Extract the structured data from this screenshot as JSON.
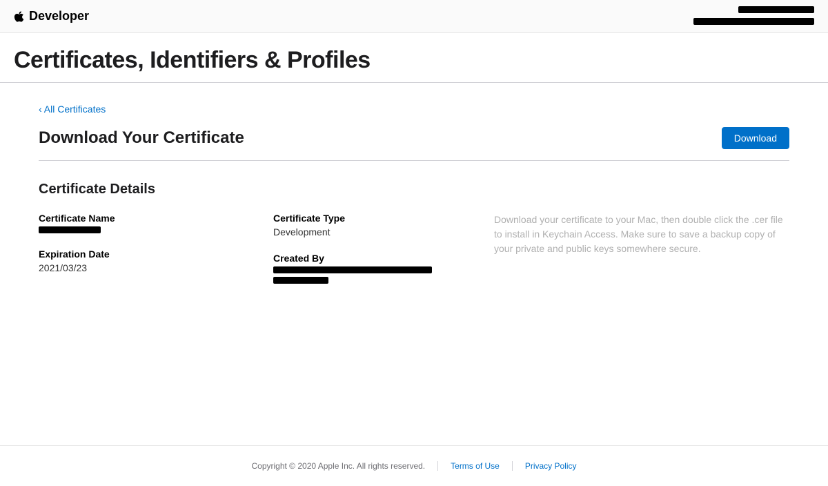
{
  "header": {
    "brand": "Developer",
    "account_line1": "[redacted]",
    "account_line2": "[redacted]"
  },
  "page": {
    "title": "Certificates, Identifiers & Profiles"
  },
  "back_link": {
    "label": "‹ All Certificates"
  },
  "section": {
    "title": "Download Your Certificate",
    "download_button": "Download"
  },
  "details": {
    "heading": "Certificate Details",
    "certificate_name_label": "Certificate Name",
    "certificate_name_value": "[redacted]",
    "expiration_date_label": "Expiration Date",
    "expiration_date_value": "2021/03/23",
    "certificate_type_label": "Certificate Type",
    "certificate_type_value": "Development",
    "created_by_label": "Created By",
    "created_by_value": "[redacted]",
    "help_text": "Download your certificate to your Mac, then double click the .cer file to install in Keychain Access. Make sure to save a backup copy of your private and public keys somewhere secure."
  },
  "footer": {
    "copyright": "Copyright © 2020 Apple Inc. All rights reserved.",
    "terms": "Terms of Use",
    "privacy": "Privacy Policy"
  }
}
